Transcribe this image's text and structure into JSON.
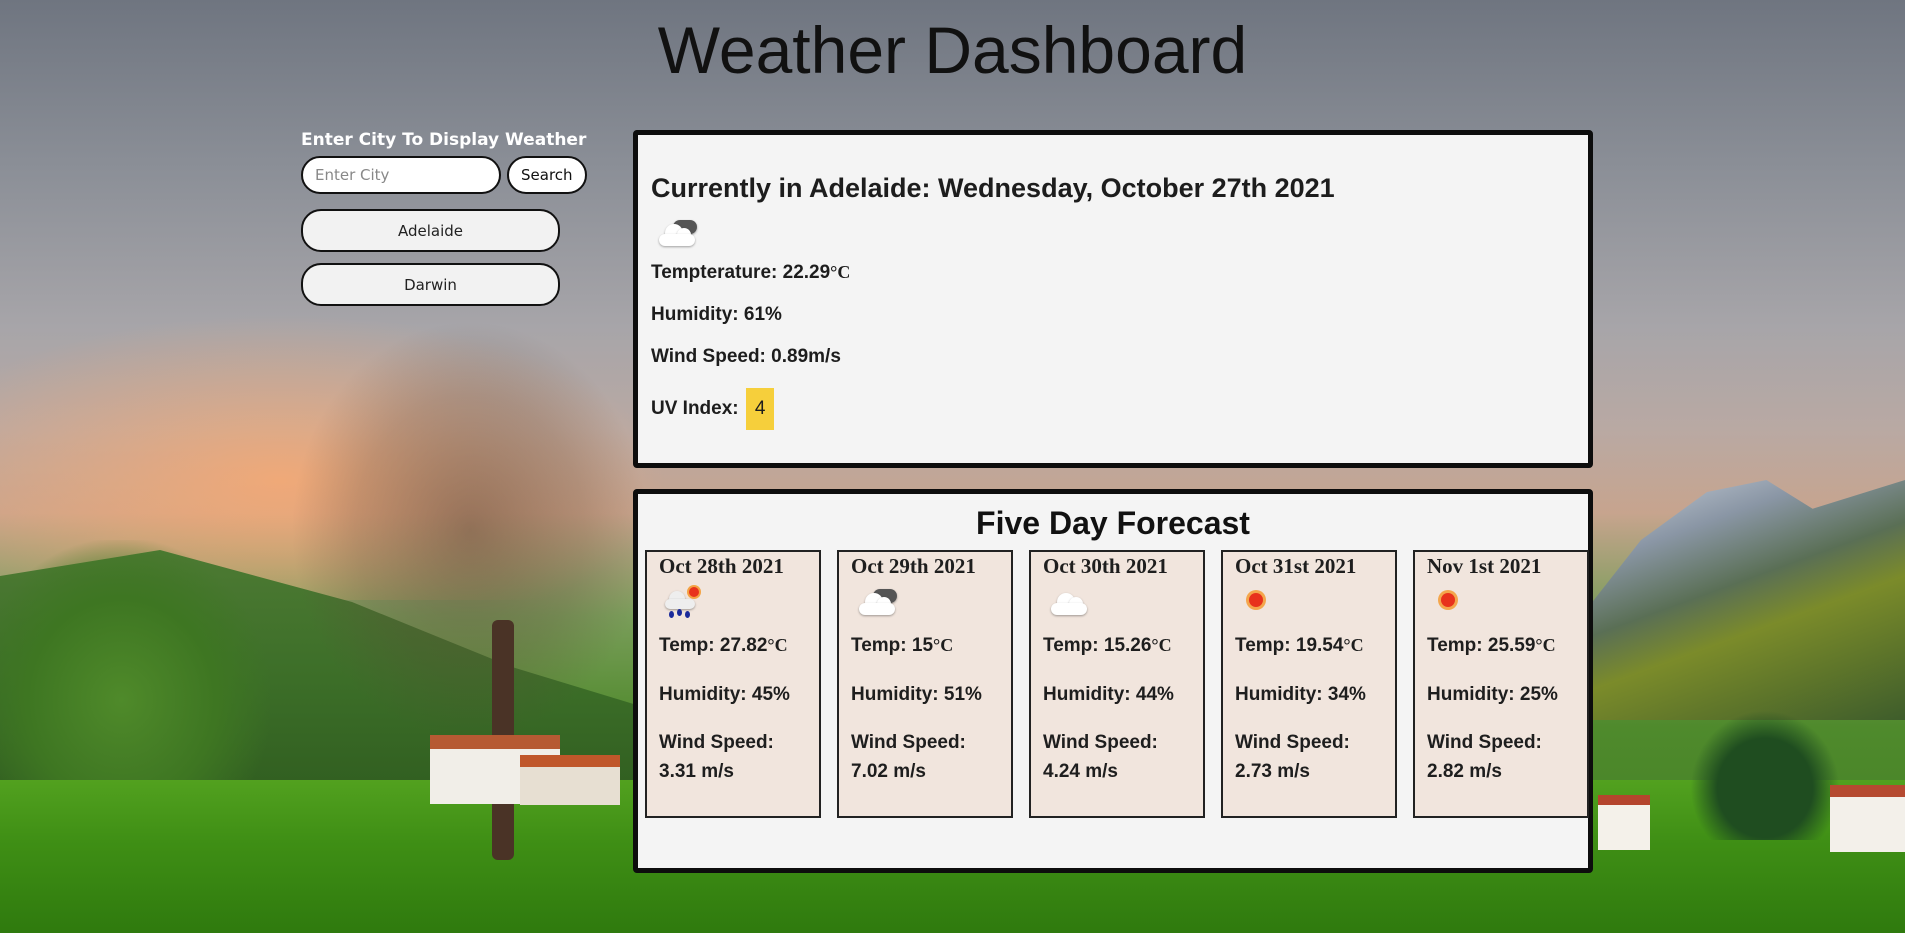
{
  "header": {
    "title": "Weather Dashboard"
  },
  "sidebar": {
    "label": "Enter City To Display Weather",
    "search_placeholder": "Enter City",
    "search_value": "",
    "search_button": "Search",
    "history": [
      {
        "label": "Adelaide"
      },
      {
        "label": "Darwin"
      }
    ]
  },
  "current": {
    "heading": "Currently in Adelaide: Wednesday, October 27th 2021",
    "icon": "cloudy-icon",
    "temp_label": "Tempteraturе: ",
    "temp_value": "22.29",
    "humidity": "Humidity: 61%",
    "wind": "Wind Speed: 0.89m/s",
    "uv_label": "UV Index: ",
    "uv_value": "4",
    "uv_color": "#f6cf3b"
  },
  "forecast": {
    "heading": "Five Day Forecast",
    "unit": "°C",
    "days": [
      {
        "date": "Oct 28th 2021",
        "icon": "rain-sun-icon",
        "temp_label": "Temp: ",
        "temp": "27.82",
        "humidity": "Humidity: 45%",
        "wind_label": "Wind Speed:",
        "wind": "3.31 m/s"
      },
      {
        "date": "Oct 29th 2021",
        "icon": "cloudy-icon",
        "temp_label": "Temp: ",
        "temp": "15",
        "humidity": "Humidity: 51%",
        "wind_label": "Wind Speed:",
        "wind": "7.02 m/s"
      },
      {
        "date": "Oct 30th 2021",
        "icon": "cloud-icon",
        "temp_label": "Temp: ",
        "temp": "15.26",
        "humidity": "Humidity: 44%",
        "wind_label": "Wind Speed:",
        "wind": "4.24 m/s"
      },
      {
        "date": "Oct 31st 2021",
        "icon": "sun-icon",
        "temp_label": "Temp: ",
        "temp": "19.54",
        "humidity": "Humidity: 34%",
        "wind_label": "Wind Speed:",
        "wind": "2.73 m/s"
      },
      {
        "date": "Nov 1st 2021",
        "icon": "sun-icon",
        "temp_label": "Temp: ",
        "temp": "25.59",
        "humidity": "Humidity: 25%",
        "wind_label": "Wind Speed:",
        "wind": "2.82 m/s"
      }
    ]
  }
}
